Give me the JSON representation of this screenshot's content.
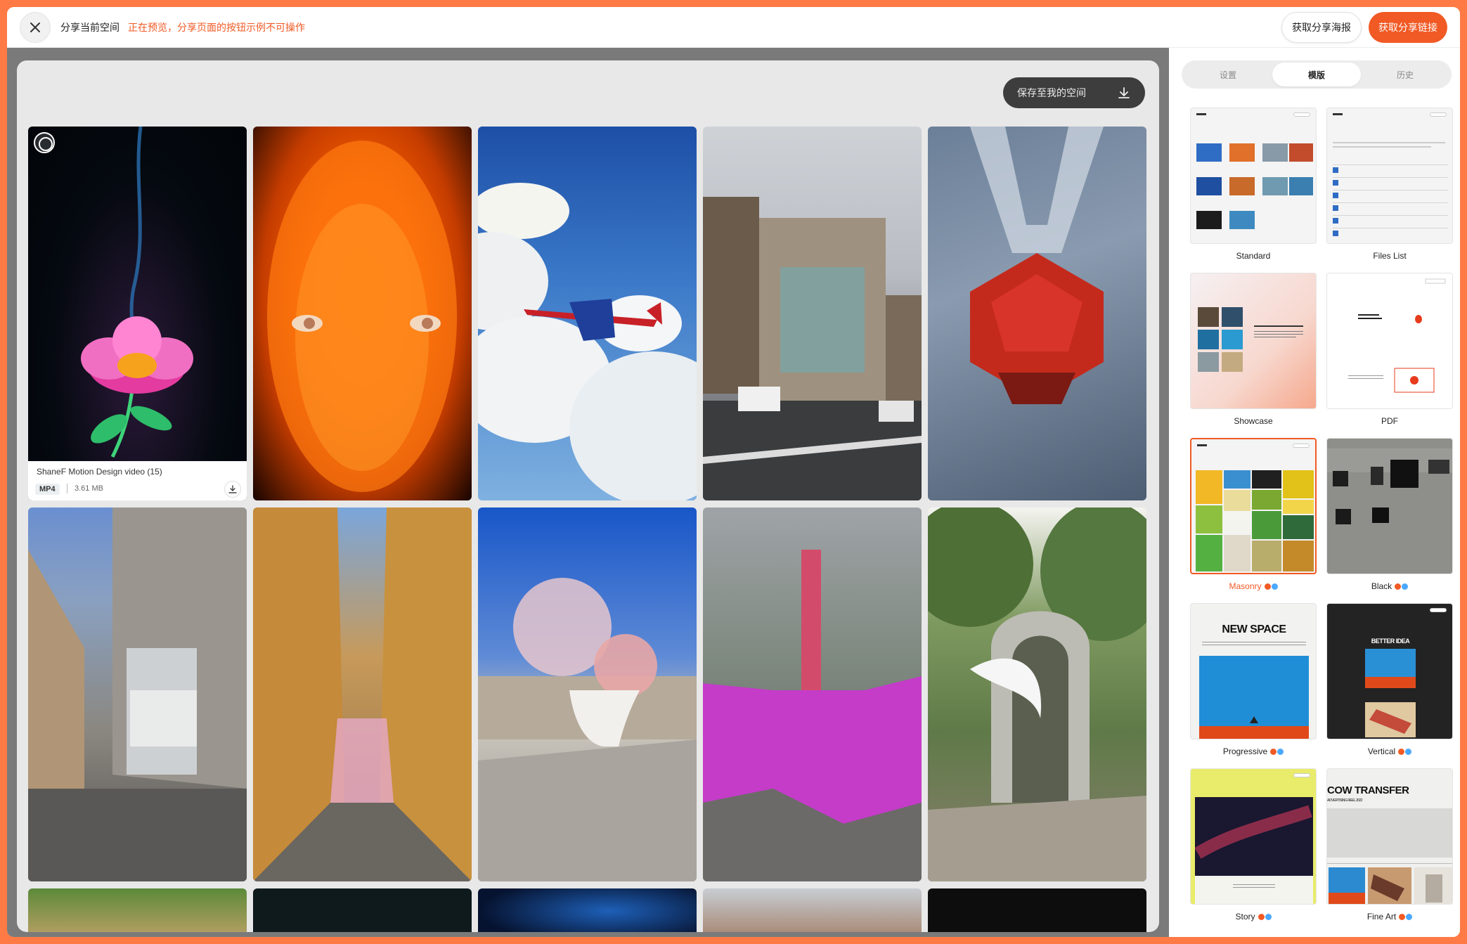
{
  "topbar": {
    "title": "分享当前空间",
    "warning": "正在预览，分享页面的按钮示例不可操作",
    "poster_label": "获取分享海报",
    "link_label": "获取分享链接"
  },
  "preview": {
    "save_label": "保存至我的空间",
    "first_item": {
      "name": "ShaneF Motion Design video (15)",
      "type": "MP4",
      "size": "3.61 MB"
    }
  },
  "panel": {
    "tabs": [
      {
        "label": "设置"
      },
      {
        "label": "模版"
      },
      {
        "label": "历史"
      }
    ],
    "templates": [
      {
        "name": "Standard"
      },
      {
        "name": "Files List"
      },
      {
        "name": "Showcase"
      },
      {
        "name": "PDF"
      },
      {
        "name": "Masonry"
      },
      {
        "name": "Black"
      },
      {
        "name": "Progressive"
      },
      {
        "name": "Vertical"
      },
      {
        "name": "Story"
      },
      {
        "name": "Fine Art"
      }
    ],
    "thumb_text": {
      "progressive": "NEW SPACE",
      "vertical": "BETTER IDEA",
      "fineart": "COW TRANSFER",
      "fineart_sub": "ADVERTISING REEL 2022",
      "pdf": "HELLO WE ARE DROP",
      "showcase": "2023SS dealfetl"
    }
  },
  "colors": {
    "accent": "#f15a24",
    "border": "#ff7a45",
    "dark_button": "#3d3d3d"
  }
}
